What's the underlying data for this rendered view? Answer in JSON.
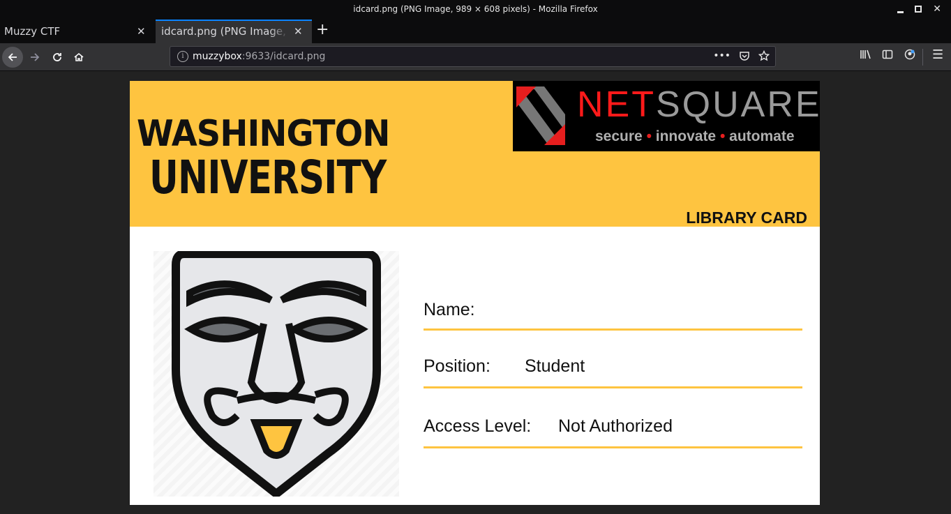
{
  "window": {
    "title": "idcard.png (PNG Image, 989 × 608 pixels) - Mozilla Firefox"
  },
  "tabs": [
    {
      "label": "Muzzy CTF"
    },
    {
      "label": "idcard.png (PNG Image, 989 × 608 pixels)"
    }
  ],
  "urlbar": {
    "host": "muzzybox",
    "rest": ":9633/idcard.png"
  },
  "card": {
    "university_line1": "WASHINGTON",
    "university_line2": "UNIVERSITY",
    "card_type": "LIBRARY CARD",
    "logo": {
      "brand_red": "NET",
      "brand_gray": "SQUARE",
      "tagline": [
        "secure",
        "innovate",
        "automate"
      ]
    },
    "fields": [
      {
        "label": "Name:",
        "value": ""
      },
      {
        "label": "Position:",
        "value": "Student"
      },
      {
        "label": "Access Level:",
        "value": "Not Authorized"
      }
    ],
    "colors": {
      "accent": "#fec440",
      "logo_red": "#ff1a1a"
    }
  },
  "icons": [
    "back-arrow-icon",
    "forward-arrow-icon",
    "reload-icon",
    "home-icon",
    "info-icon",
    "more-icon",
    "pocket-icon",
    "bookmark-star-icon",
    "library-icon",
    "sidebar-icon",
    "account-icon",
    "hamburger-menu-icon"
  ]
}
